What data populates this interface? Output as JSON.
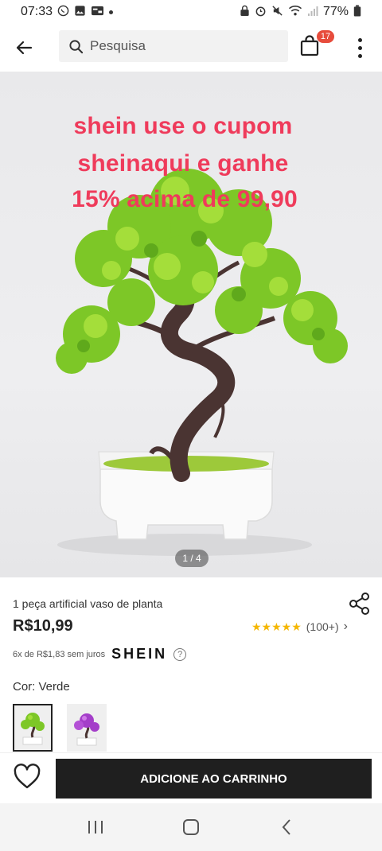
{
  "status_bar": {
    "time": "07:33",
    "battery": "77%"
  },
  "header": {
    "search_placeholder": "Pesquisa",
    "cart_count": "17"
  },
  "gallery": {
    "promo_lines": [
      "shein use o cupom",
      "sheinaqui e ganhe",
      "15% acima de 99,90"
    ],
    "counter": "1 / 4",
    "promo_color": "#ef3b5b"
  },
  "product": {
    "title": "1 peça artificial vaso de planta",
    "price": "R$10,99",
    "rating_stars": "★★★★★",
    "rating_count": "(100+)",
    "installment": "6x de R$1,83 sem juros",
    "brand_logo": "SHEIN",
    "color_label": "Cor: Verde",
    "swatches": [
      "green-bonsai",
      "purple-bonsai"
    ]
  },
  "actions": {
    "add_to_cart": "ADICIONE AO CARRINHO"
  },
  "icons": {
    "back": "arrow-left-icon",
    "search": "search-icon",
    "cart": "shopping-bag-icon",
    "more": "kebab-menu-icon",
    "share": "share-icon",
    "wishlist": "heart-icon",
    "help": "question-icon"
  }
}
